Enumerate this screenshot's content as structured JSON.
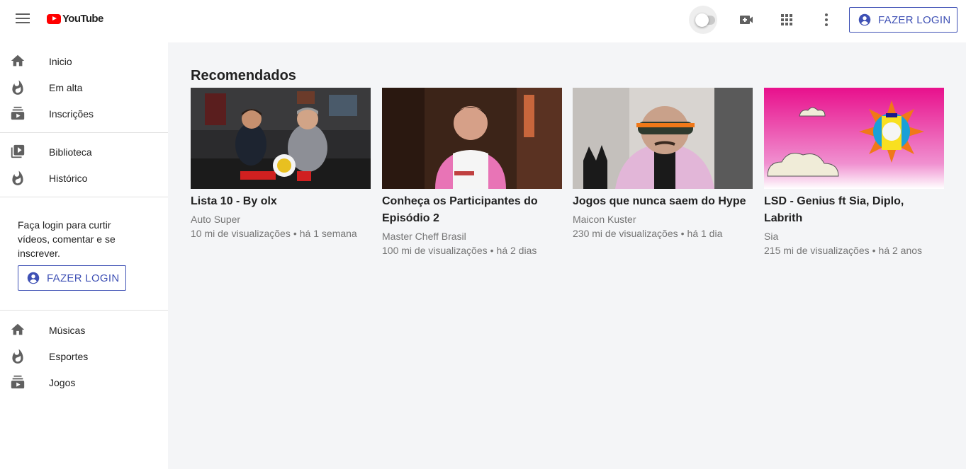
{
  "header": {
    "logo_text": "YouTube",
    "login_label": "FAZER LOGIN"
  },
  "sidebar": {
    "items": [
      {
        "label": "Inicio",
        "icon": "home-icon"
      },
      {
        "label": "Em alta",
        "icon": "fire-icon"
      },
      {
        "label": "Inscrições",
        "icon": "subscriptions-icon"
      },
      {
        "label": "Biblioteca",
        "icon": "library-icon"
      },
      {
        "label": "Histórico",
        "icon": "fire-icon"
      }
    ],
    "signin_message": "Faça login para curtir vídeos, comentar e se inscrever.",
    "login_label": "FAZER LOGIN",
    "categories": [
      {
        "label": "Músicas",
        "icon": "home-icon"
      },
      {
        "label": "Esportes",
        "icon": "fire-icon"
      },
      {
        "label": "Jogos",
        "icon": "subscriptions-icon"
      }
    ]
  },
  "main": {
    "section_title": "Recomendados",
    "videos": [
      {
        "title": "Lista 10 - By olx",
        "channel": "Auto Super",
        "views": "10 mi de visualizações",
        "age": "há 1 semana"
      },
      {
        "title": "Conheça os Participantes do Episódio 2",
        "channel": "Master Cheff Brasil",
        "views": "100 mi de visualizações",
        "age": "há 2 dias"
      },
      {
        "title": "Jogos que nunca saem do Hype",
        "channel": "Maicon Kuster",
        "views": "230 mi de visualizações",
        "age": "há 1 dia"
      },
      {
        "title": "LSD - Genius ft Sia, Diplo, Labrith",
        "channel": "Sia",
        "views": "215 mi de visualizações",
        "age": "há 2 anos"
      }
    ],
    "meta_separator": "•"
  },
  "colors": {
    "brand_red": "#ff0000",
    "accent_blue": "#3f51b5",
    "main_bg": "#f4f5f7"
  }
}
